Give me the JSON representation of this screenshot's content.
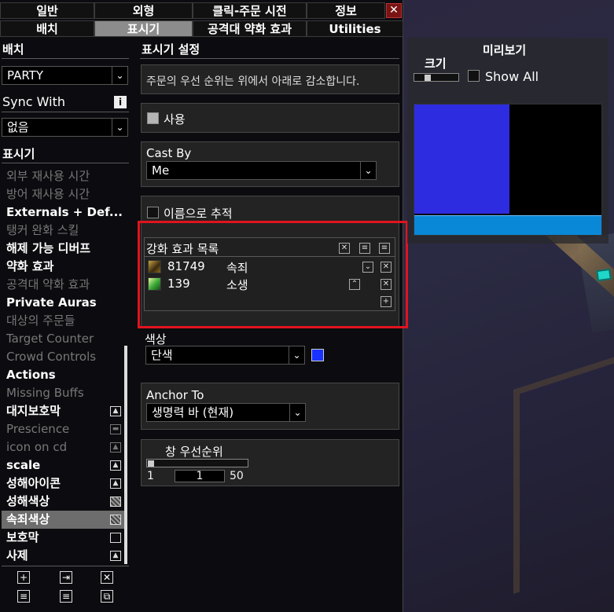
{
  "tabs_row1": [
    "일반",
    "외형",
    "클릭-주문 시전",
    "정보"
  ],
  "tabs_row2": [
    "배치",
    "표시기",
    "공격대 약화 효과",
    "Utilities"
  ],
  "active_tab": "표시기",
  "close_label": "✕",
  "left": {
    "layout_label": "배치",
    "layout_value": "PARTY",
    "sync_label": "Sync With",
    "sync_value": "없음",
    "info_label": "i",
    "indicators_label": "표시기",
    "items": [
      {
        "label": "외부 재사용 시간",
        "style": "gray"
      },
      {
        "label": "방어 재사용 시간",
        "style": "gray"
      },
      {
        "label": "Externals + Def...",
        "style": "white"
      },
      {
        "label": "탱커 완화 스킬",
        "style": "gray"
      },
      {
        "label": "해제 가능 디버프",
        "style": "white"
      },
      {
        "label": "약화 효과",
        "style": "white"
      },
      {
        "label": "공격대 약화 효과",
        "style": "gray"
      },
      {
        "label": "Private Auras",
        "style": "white"
      },
      {
        "label": "대상의 주문들",
        "style": "gray"
      },
      {
        "label": "Target Counter",
        "style": "gray"
      },
      {
        "label": "Crowd Controls",
        "style": "gray"
      },
      {
        "label": "Actions",
        "style": "white"
      },
      {
        "label": "Missing Buffs",
        "style": "gray"
      },
      {
        "label": "대지보호막",
        "style": "white",
        "icon": "image-icon"
      },
      {
        "label": "Prescience",
        "style": "gray",
        "icon": "bar-icon"
      },
      {
        "label": "icon on cd",
        "style": "gray",
        "icon": "image-icon"
      },
      {
        "label": "scale",
        "style": "white",
        "icon": "image-icon"
      },
      {
        "label": "성해아이콘",
        "style": "white",
        "icon": "image-icon"
      },
      {
        "label": "성해색상",
        "style": "white",
        "icon": "checker-icon"
      },
      {
        "label": "속죄색상",
        "style": "white",
        "icon": "checker-icon",
        "selected": true
      },
      {
        "label": "보호막",
        "style": "white",
        "icon": "square-icon"
      },
      {
        "label": "사제",
        "style": "white",
        "icon": "image-icon"
      }
    ],
    "tools": [
      "+",
      "⇥",
      "✕",
      "≡",
      "≡",
      "⧉"
    ]
  },
  "settings": {
    "title": "표시기 설정",
    "description": "주문의 우선 순위는 위에서 아래로 감소합니다.",
    "enable_label": "사용",
    "cast_by_label": "Cast By",
    "cast_by_value": "Me",
    "track_by_name_label": "이름으로 추적",
    "aura_list_label": "강화 효과 목록",
    "auras": [
      {
        "id": "81749",
        "name": "속죄"
      },
      {
        "id": "139",
        "name": "소생"
      }
    ],
    "color_label": "색상",
    "color_value": "단색",
    "color_hex": "#1a32ff",
    "anchor_label": "Anchor To",
    "anchor_value": "생명력 바 (현재)",
    "frame_level_label": "창 우선순위",
    "frame_level_min": "1",
    "frame_level_value": "1",
    "frame_level_max": "50"
  },
  "preview": {
    "title": "미리보기",
    "size_label": "크기",
    "show_all_label": "Show All",
    "indicator_color": "#2d2ce0",
    "health_bar_color": "#0a88d8"
  }
}
